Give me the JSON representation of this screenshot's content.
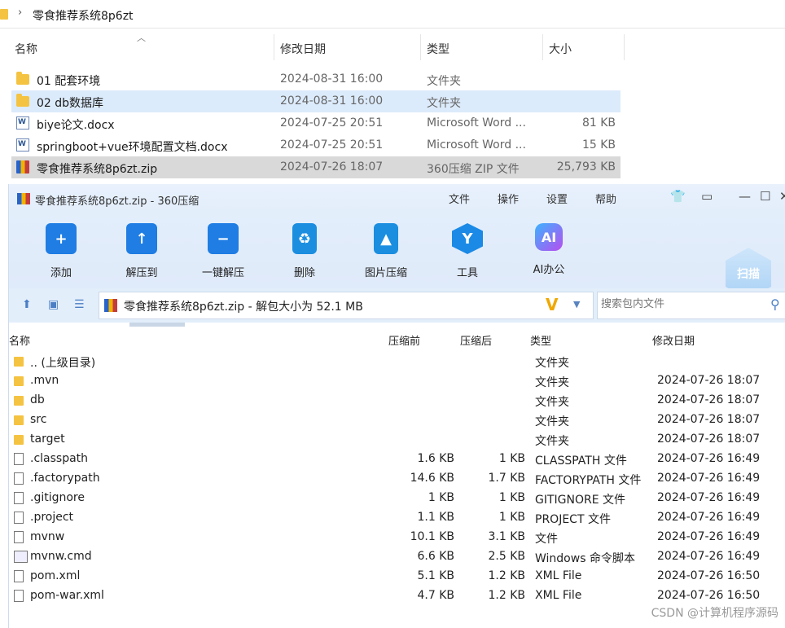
{
  "explorer": {
    "path": "零食推荐系统8p6zt",
    "columns": {
      "name": "名称",
      "date": "修改日期",
      "type": "类型",
      "size": "大小"
    },
    "rows": [
      {
        "name": "01 配套环境",
        "date": "2024-08-31 16:00",
        "type": "文件夹",
        "size": "",
        "icon": "folder-icon"
      },
      {
        "name": "02 db数据库",
        "date": "2024-08-31 16:00",
        "type": "文件夹",
        "size": "",
        "icon": "folder-icon"
      },
      {
        "name": "biye论文.docx",
        "date": "2024-07-25 20:51",
        "type": "Microsoft Word ...",
        "size": "81 KB",
        "icon": "word-doc-icon"
      },
      {
        "name": "springboot+vue环境配置文档.docx",
        "date": "2024-07-25 20:51",
        "type": "Microsoft Word ...",
        "size": "15 KB",
        "icon": "word-doc-icon"
      },
      {
        "name": "零食推荐系统8p6zt.zip",
        "date": "2024-07-26 18:07",
        "type": "360压缩 ZIP 文件",
        "size": "25,793 KB",
        "icon": "zip-icon"
      }
    ]
  },
  "zip_window": {
    "title": "零食推荐系统8p6zt.zip - 360压缩",
    "menu": [
      "文件",
      "操作",
      "设置",
      "帮助"
    ],
    "tools": [
      {
        "label": "添加",
        "icon": "add-icon"
      },
      {
        "label": "解压到",
        "icon": "extract-to-icon"
      },
      {
        "label": "一键解压",
        "icon": "one-click-extract-icon"
      },
      {
        "label": "删除",
        "icon": "delete-icon"
      },
      {
        "label": "图片压缩",
        "icon": "image-compress-icon"
      },
      {
        "label": "工具",
        "icon": "tools-icon"
      },
      {
        "label": "AI办公",
        "icon": "ai-office-icon"
      }
    ],
    "scan_label": "扫描",
    "address": "零食推荐系统8p6zt.zip - 解包大小为 52.1 MB",
    "search_placeholder": "搜索包内文件",
    "columns": {
      "name": "名称",
      "before": "压缩前",
      "after": "压缩后",
      "type": "类型",
      "date": "修改日期"
    },
    "rows": [
      {
        "name": ".. (上级目录)",
        "before": "",
        "after": "",
        "type": "文件夹",
        "date": "",
        "icon": "folder"
      },
      {
        "name": ".mvn",
        "before": "",
        "after": "",
        "type": "文件夹",
        "date": "2024-07-26 18:07",
        "icon": "folder"
      },
      {
        "name": "db",
        "before": "",
        "after": "",
        "type": "文件夹",
        "date": "2024-07-26 18:07",
        "icon": "folder"
      },
      {
        "name": "src",
        "before": "",
        "after": "",
        "type": "文件夹",
        "date": "2024-07-26 18:07",
        "icon": "folder"
      },
      {
        "name": "target",
        "before": "",
        "after": "",
        "type": "文件夹",
        "date": "2024-07-26 18:07",
        "icon": "folder"
      },
      {
        "name": ".classpath",
        "before": "1.6 KB",
        "after": "1 KB",
        "type": "CLASSPATH 文件",
        "date": "2024-07-26 16:49",
        "icon": "file"
      },
      {
        "name": ".factorypath",
        "before": "14.6 KB",
        "after": "1.7 KB",
        "type": "FACTORYPATH 文件",
        "date": "2024-07-26 16:49",
        "icon": "file"
      },
      {
        "name": ".gitignore",
        "before": "1 KB",
        "after": "1 KB",
        "type": "GITIGNORE 文件",
        "date": "2024-07-26 16:49",
        "icon": "file"
      },
      {
        "name": ".project",
        "before": "1.1 KB",
        "after": "1 KB",
        "type": "PROJECT 文件",
        "date": "2024-07-26 16:49",
        "icon": "file"
      },
      {
        "name": "mvnw",
        "before": "10.1 KB",
        "after": "3.1 KB",
        "type": "文件",
        "date": "2024-07-26 16:49",
        "icon": "file"
      },
      {
        "name": "mvnw.cmd",
        "before": "6.6 KB",
        "after": "2.5 KB",
        "type": "Windows 命令脚本",
        "date": "2024-07-26 16:49",
        "icon": "cmd"
      },
      {
        "name": "pom.xml",
        "before": "5.1 KB",
        "after": "1.2 KB",
        "type": "XML File",
        "date": "2024-07-26 16:50",
        "icon": "file"
      },
      {
        "name": "pom-war.xml",
        "before": "4.7 KB",
        "after": "1.2 KB",
        "type": "XML File",
        "date": "2024-07-26 16:50",
        "icon": "file"
      }
    ]
  },
  "watermark": "CSDN @计算机程序源码"
}
